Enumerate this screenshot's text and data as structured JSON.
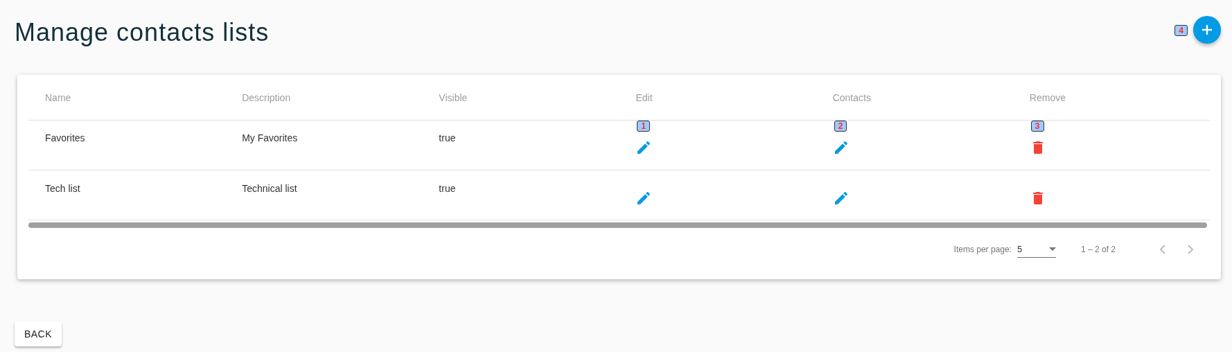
{
  "page": {
    "title": "Manage contacts lists"
  },
  "add_button": {
    "marker": "4"
  },
  "table": {
    "columns": [
      "Name",
      "Description",
      "Visible",
      "Edit",
      "Contacts",
      "Remove"
    ],
    "rows": [
      {
        "name": "Favorites",
        "description": "My Favorites",
        "visible": "true",
        "markers": [
          "1",
          "2",
          "3"
        ]
      },
      {
        "name": "Tech list",
        "description": "Technical list",
        "visible": "true",
        "markers": []
      }
    ]
  },
  "paginator": {
    "label": "Items per page:",
    "page_size": "5",
    "range": "1 – 2 of 2",
    "prev_disabled": true,
    "next_disabled": true
  },
  "back_button": {
    "label": "BACK"
  }
}
